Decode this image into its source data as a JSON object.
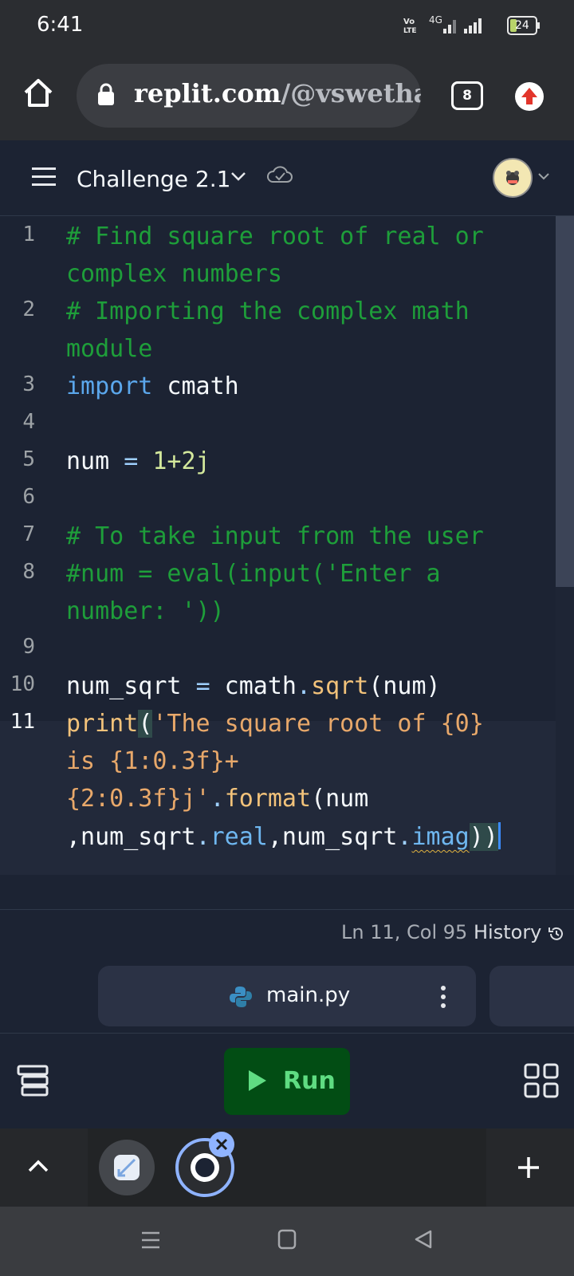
{
  "status_bar": {
    "time": "6:41",
    "battery": "24",
    "network": "4G"
  },
  "browser": {
    "url_host": "replit.com",
    "url_path": "/@vswethacs",
    "tab_count": "8"
  },
  "header": {
    "title": "Challenge 2.1"
  },
  "editor": {
    "line_numbers": [
      "1",
      "2",
      "3",
      "4",
      "5",
      "6",
      "7",
      "8",
      "9",
      "10",
      "11"
    ],
    "lines": {
      "l1a": "# Find square root of real or",
      "l1b": "complex numbers",
      "l2a": "# Importing the complex math",
      "l2b": "module",
      "l3_kw": "import",
      "l3_rest": " cmath",
      "l5_a": "num ",
      "l5_op": "=",
      "l5_sp": " ",
      "l5_num": "1+2j",
      "l7": "# To take input from the user",
      "l8a": "#num = eval(input('Enter a",
      "l8b": "number: '))",
      "l10_a": "num_sqrt ",
      "l10_op": "=",
      "l10_b": " cmath",
      "l10_dot": ".",
      "l10_fn": "sqrt",
      "l10_c": "(num)",
      "l11_fn": "print",
      "l11_paren": "(",
      "l11_str1": "'The square root of {0}",
      "l11_str2": "is {1:0.3f}+",
      "l11_str3": "{2:0.3f}j'",
      "l11_dot": ".",
      "l11_format": "format",
      "l11_rest": "(num",
      "l11_l4a": ",num_sqrt",
      "l11_l4dot1": ".",
      "l11_real": "real",
      "l11_l4b": ",num_sqrt",
      "l11_l4dot2": ".",
      "l11_imag": "imag",
      "l11_close": "))"
    }
  },
  "footer": {
    "position": "Ln 11, Col 95",
    "history_label": "History"
  },
  "file_tab": {
    "name": "main.py"
  },
  "actions": {
    "run_label": "Run"
  },
  "colors": {
    "run_bg": "#024d14",
    "run_text": "#5fdc82",
    "editor_bg": "#1c2333"
  }
}
